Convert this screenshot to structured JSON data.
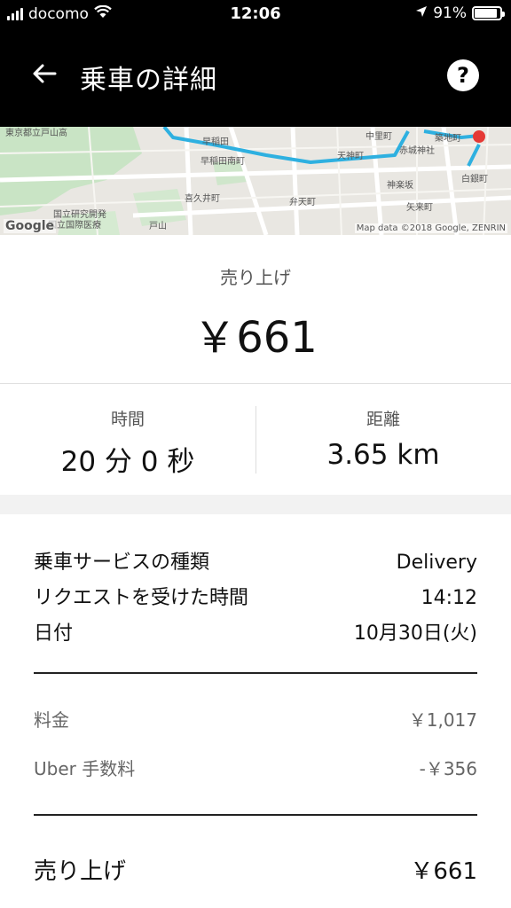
{
  "status_bar": {
    "carrier": "docomo",
    "time": "12:06",
    "battery": "91%",
    "battery_level": 0.91
  },
  "header": {
    "title": "乗車の詳細",
    "back_icon": "arrow-left-icon",
    "help_label": "?"
  },
  "map": {
    "google_label": "Google",
    "attribution": "Map data ©2018 Google, ZENRIN",
    "place_labels": [
      "早稲田",
      "早稲田南町",
      "天神町",
      "中里町",
      "赤城神社",
      "神楽坂",
      "喜久井町",
      "弁天町",
      "矢来町",
      "白銀町",
      "築地町",
      "戸山",
      "東京都立戸山高",
      "国立研究開発",
      "国立国際医療"
    ]
  },
  "earnings": {
    "label": "売り上げ",
    "amount": "￥661"
  },
  "stats": {
    "time_label": "時間",
    "time_value": "20 分 0 秒",
    "distance_label": "距離",
    "distance_value": "3.65 km"
  },
  "details": {
    "service_type_label": "乗車サービスの種類",
    "service_type_value": "Delivery",
    "request_time_label": "リクエストを受けた時間",
    "request_time_value": "14:12",
    "date_label": "日付",
    "date_value": "10月30日(火)",
    "fare_label": "料金",
    "fare_value": "￥1,017",
    "fee_label": "Uber 手数料",
    "fee_value": "-￥356",
    "total_label": "売り上げ",
    "total_value": "￥661"
  }
}
